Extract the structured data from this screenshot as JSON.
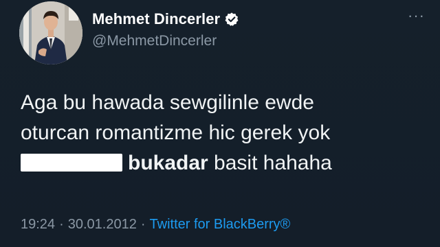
{
  "author": {
    "display_name": "Mehmet Dincerler",
    "handle": "@MehmetDincerler",
    "verified": true,
    "avatar_icon": "profile-photo"
  },
  "more_icon": "more-icon",
  "more_glyph": "···",
  "tweet": {
    "line1": "Aga bu hawada sewgilinle ewde",
    "line2": "oturcan romantizme hic gerek yok",
    "line3_bold": "bukadar",
    "line3_rest": " basit hahaha"
  },
  "meta": {
    "time": "19:24",
    "separator": "·",
    "date": "30.01.2012",
    "source": "Twitter for BlackBerry®"
  },
  "colors": {
    "background": "#15202b",
    "accent": "#1d9bf0",
    "secondary_text": "#8b98a5"
  }
}
